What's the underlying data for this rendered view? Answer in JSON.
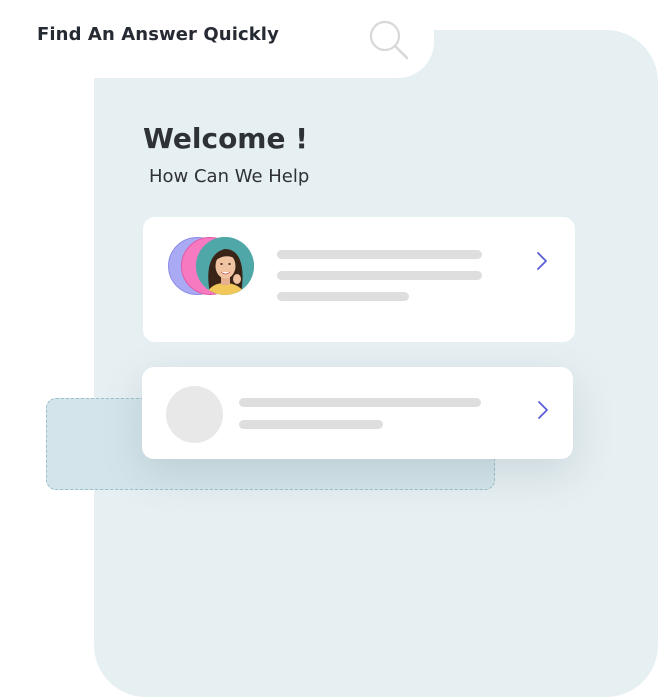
{
  "header": {
    "title": "Find An Answer Quickly",
    "search_icon": "search-icon"
  },
  "main": {
    "welcome": "Welcome !",
    "subtitle": "How Can We Help"
  },
  "cards": [
    {
      "icon": "chevron-right-icon",
      "avatar": "profile-photo-stack"
    },
    {
      "icon": "chevron-right-icon",
      "avatar": "placeholder-avatar"
    }
  ],
  "colors": {
    "panel": "#e6eff2",
    "accent": "#5b5fd6",
    "avatar_purple": "#a9a9f4",
    "avatar_pink": "#f77ac0",
    "avatar_teal": "#4fa7a8"
  }
}
